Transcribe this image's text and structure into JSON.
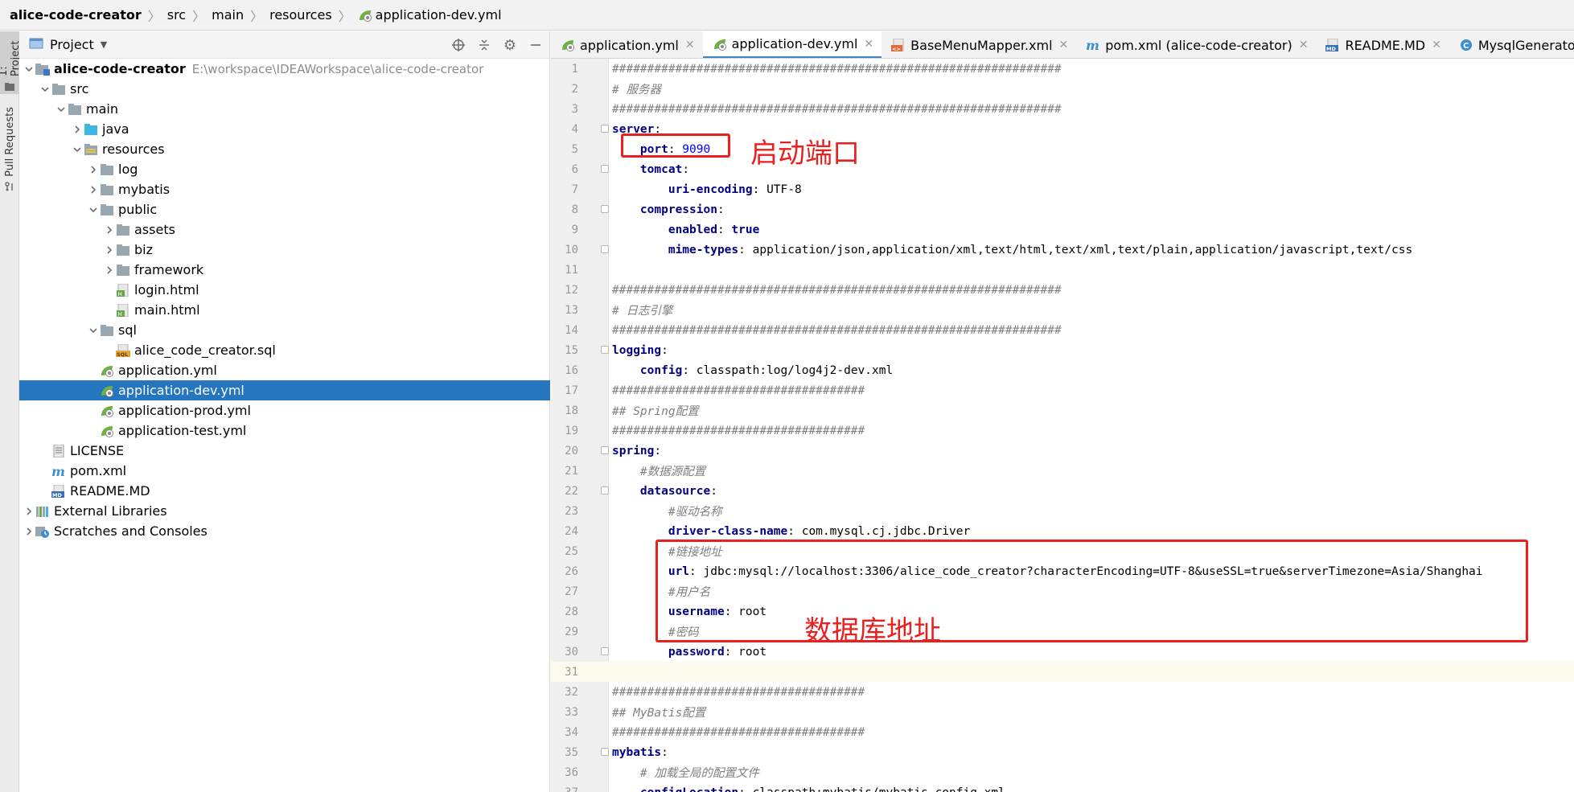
{
  "breadcrumb": [
    "alice-code-creator",
    "src",
    "main",
    "resources",
    "application-dev.yml"
  ],
  "stripe": {
    "project_label": "1: Project",
    "pull_label": "Pull Requests"
  },
  "project_panel": {
    "title": "Project"
  },
  "tree": [
    {
      "label": "alice-code-creator",
      "bold": true,
      "path": "E:\\workspace\\IDEAWorkspace\\alice-code-creator",
      "depth": 0,
      "arrow": "down",
      "icon": "module-folder-icon"
    },
    {
      "label": "src",
      "depth": 1,
      "arrow": "down",
      "icon": "folder-icon"
    },
    {
      "label": "main",
      "depth": 2,
      "arrow": "down",
      "icon": "folder-icon"
    },
    {
      "label": "java",
      "depth": 3,
      "arrow": "right",
      "icon": "source-folder-icon"
    },
    {
      "label": "resources",
      "depth": 3,
      "arrow": "down",
      "icon": "resources-folder-icon"
    },
    {
      "label": "log",
      "depth": 4,
      "arrow": "right",
      "icon": "folder-icon"
    },
    {
      "label": "mybatis",
      "depth": 4,
      "arrow": "right",
      "icon": "folder-icon"
    },
    {
      "label": "public",
      "depth": 4,
      "arrow": "down",
      "icon": "folder-icon"
    },
    {
      "label": "assets",
      "depth": 5,
      "arrow": "right",
      "icon": "folder-icon"
    },
    {
      "label": "biz",
      "depth": 5,
      "arrow": "right",
      "icon": "folder-icon"
    },
    {
      "label": "framework",
      "depth": 5,
      "arrow": "right",
      "icon": "folder-icon"
    },
    {
      "label": "login.html",
      "depth": 5,
      "arrow": "none",
      "icon": "html-file-icon"
    },
    {
      "label": "main.html",
      "depth": 5,
      "arrow": "none",
      "icon": "html-file-icon"
    },
    {
      "label": "sql",
      "depth": 4,
      "arrow": "down",
      "icon": "folder-icon"
    },
    {
      "label": "alice_code_creator.sql",
      "depth": 5,
      "arrow": "none",
      "icon": "sql-file-icon"
    },
    {
      "label": "application.yml",
      "depth": 4,
      "arrow": "none",
      "icon": "spring-yml-icon"
    },
    {
      "label": "application-dev.yml",
      "depth": 4,
      "arrow": "none",
      "icon": "spring-yml-icon",
      "selected": true
    },
    {
      "label": "application-prod.yml",
      "depth": 4,
      "arrow": "none",
      "icon": "spring-yml-icon"
    },
    {
      "label": "application-test.yml",
      "depth": 4,
      "arrow": "none",
      "icon": "spring-yml-icon"
    },
    {
      "label": "LICENSE",
      "depth": 1,
      "arrow": "none",
      "icon": "text-file-icon"
    },
    {
      "label": "pom.xml",
      "depth": 1,
      "arrow": "none",
      "icon": "maven-icon"
    },
    {
      "label": "README.MD",
      "depth": 1,
      "arrow": "none",
      "icon": "markdown-icon"
    },
    {
      "label": "External Libraries",
      "depth": 0,
      "arrow": "right",
      "icon": "libraries-icon"
    },
    {
      "label": "Scratches and Consoles",
      "depth": 0,
      "arrow": "right",
      "icon": "scratches-icon"
    }
  ],
  "tabs": [
    {
      "label": "application.yml",
      "icon": "spring-yml-icon"
    },
    {
      "label": "application-dev.yml",
      "icon": "spring-yml-icon",
      "active": true
    },
    {
      "label": "BaseMenuMapper.xml",
      "icon": "xml-file-icon"
    },
    {
      "label": "pom.xml (alice-code-creator)",
      "icon": "maven-icon"
    },
    {
      "label": "README.MD",
      "icon": "markdown-icon"
    },
    {
      "label": "MysqlGeneratorServiceImpl.j",
      "icon": "class-icon",
      "noclose": true
    }
  ],
  "code_lines": [
    "################################################################",
    "# 服务器",
    "################################################################",
    "server:",
    "    port: 9090",
    "    tomcat:",
    "        uri-encoding: UTF-8",
    "    compression:",
    "        enabled: true",
    "        mime-types: application/json,application/xml,text/html,text/xml,text/plain,application/javascript,text/css",
    "",
    "################################################################",
    "# 日志引擎",
    "################################################################",
    "logging:",
    "    config: classpath:log/log4j2-dev.xml",
    "####################################",
    "## Spring配置",
    "####################################",
    "spring:",
    "    #数据源配置",
    "    datasource:",
    "        #驱动名称",
    "        driver-class-name: com.mysql.cj.jdbc.Driver",
    "        #链接地址",
    "        url: jdbc:mysql://localhost:3306/alice_code_creator?characterEncoding=UTF-8&useSSL=true&serverTimezone=Asia/Shanghai",
    "        #用户名",
    "        username: root",
    "        #密码",
    "        password: root",
    "",
    "####################################",
    "## MyBatis配置",
    "####################################",
    "mybatis:",
    "    # 加载全局的配置文件",
    "    configLocation: classpath:mybatis/mybatis-config.xml"
  ],
  "annotations": {
    "port_label": "启动端口",
    "datasource_label": "数据库地址"
  },
  "colors": {
    "selection": "#2675bf",
    "annotation": "#e8201e",
    "yaml_key": "#000080"
  }
}
